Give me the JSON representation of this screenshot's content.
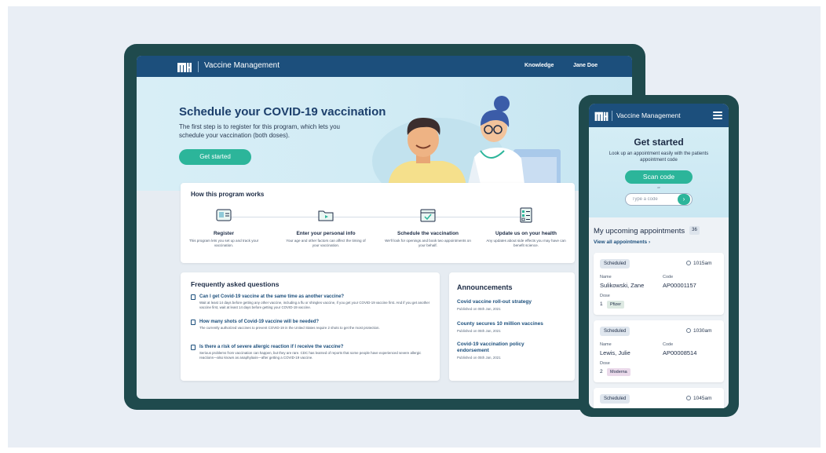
{
  "tablet": {
    "nav": {
      "title": "Vaccine Management",
      "knowledge": "Knowledge",
      "user": "Jane Doe"
    },
    "hero": {
      "title": "Schedule your COVID-19 vaccination",
      "subtitle": "The first step is to register for this program, which lets you schedule your vaccination (both doses).",
      "button": "Get started"
    },
    "how": {
      "title": "How this program works",
      "steps": [
        {
          "icon": "id-card-icon",
          "title": "Register",
          "desc": "This program lets you set up and track your vaccination."
        },
        {
          "icon": "folder-icon",
          "title": "Enter your personal info",
          "desc": "Your age and other factors can affect the timing of your vaccination."
        },
        {
          "icon": "calendar-check-icon",
          "title": "Schedule the vaccination",
          "desc": "We'll look for openings and book two appointments on your behalf."
        },
        {
          "icon": "checklist-icon",
          "title": "Update us on your health",
          "desc": "Any updates about side effects you may have can benefit science."
        }
      ]
    },
    "faq": {
      "title": "Frequently asked questions",
      "items": [
        {
          "q": "Can I get Covid-19 vaccine at the same time as another vaccine?",
          "a": "Wait at least 14 days before getting any other vaccine, including a flu or shingles vaccine, if you get your COVID-19 vaccine first. And if you get another vaccine first, wait at least 14 days before getting your COVID-19 vaccine."
        },
        {
          "q": "How many shots of Covid-19 vaccine will be needed?",
          "a": "The currently authorized vaccines to prevent COVID-19 in the United States require 2 shots to get the most protection."
        },
        {
          "q": "Is there a risk of severe allergic reaction if I receive the vaccine?",
          "a": "Serious problems from vaccination can happen, but they are rare. CDC has learned of reports that some people have experienced severe allergic reactions—also known as anaphylaxis—after getting a COVID-19 vaccine."
        }
      ]
    },
    "announcements": {
      "title": "Announcements",
      "items": [
        {
          "title": "Covid vaccine roll-out strategy",
          "date": "Published on 05th Jan, 2021"
        },
        {
          "title": "County secures 10 million vaccines",
          "date": "Published on 05th Jan, 2021"
        },
        {
          "title": "Covid-19 vaccination policy endorsement",
          "date": "Published on 05th Jan, 2021"
        }
      ]
    }
  },
  "phone": {
    "nav": {
      "title": "Vaccine Management"
    },
    "hero": {
      "title": "Get started",
      "subtitle": "Look up an appointment easily with the patients appointment code",
      "button": "Scan code",
      "or": "or",
      "placeholder": "Type a code"
    },
    "upcoming": {
      "title": "My upcoming appointments",
      "count": "36",
      "view_all": "View all appointments"
    },
    "labels": {
      "name": "Name",
      "code": "Code",
      "dose": "Dose"
    },
    "appointments": [
      {
        "status": "Scheduled",
        "time": "1015am",
        "name": "Sulikowski, Zane",
        "code": "AP00001157",
        "dose": "1",
        "vaccine": "Pfizer",
        "vaccine_color": "#dde9e2"
      },
      {
        "status": "Scheduled",
        "time": "1030am",
        "name": "Lewis, Julie",
        "code": "AP00008514",
        "dose": "2",
        "vaccine": "Moderna",
        "vaccine_color": "#ead9ea"
      },
      {
        "status": "Scheduled",
        "time": "1045am"
      }
    ]
  },
  "colors": {
    "navy": "#1c4f7c",
    "teal": "#2cb59a",
    "frame": "#1f4a4d"
  }
}
